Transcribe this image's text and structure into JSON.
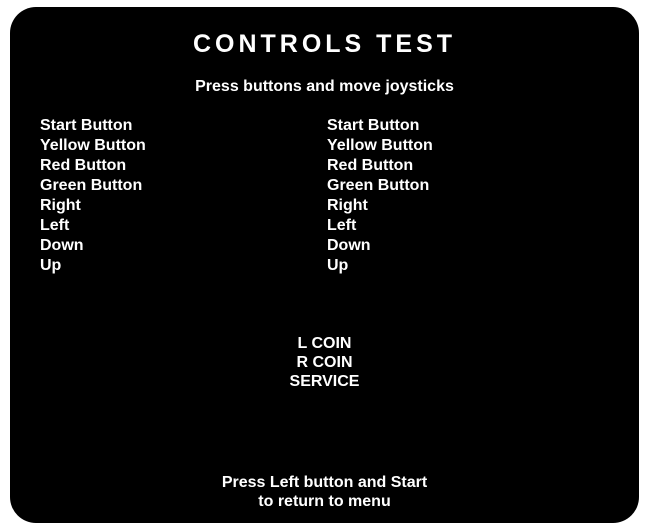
{
  "screen": {
    "title": "CONTROLS TEST",
    "subtitle": "Press buttons and move joysticks",
    "player1_controls": [
      "Start Button",
      "Yellow Button",
      "Red Button",
      "Green Button",
      "Right",
      "Left",
      "Down",
      "Up"
    ],
    "player2_controls": [
      "Start Button",
      "Yellow Button",
      "Red Button",
      "Green Button",
      "Right",
      "Left",
      "Down",
      "Up"
    ],
    "switches": [
      "L COIN",
      "R COIN",
      "SERVICE"
    ],
    "footer_line1": "Press Left button and Start",
    "footer_line2": "to return to menu"
  }
}
